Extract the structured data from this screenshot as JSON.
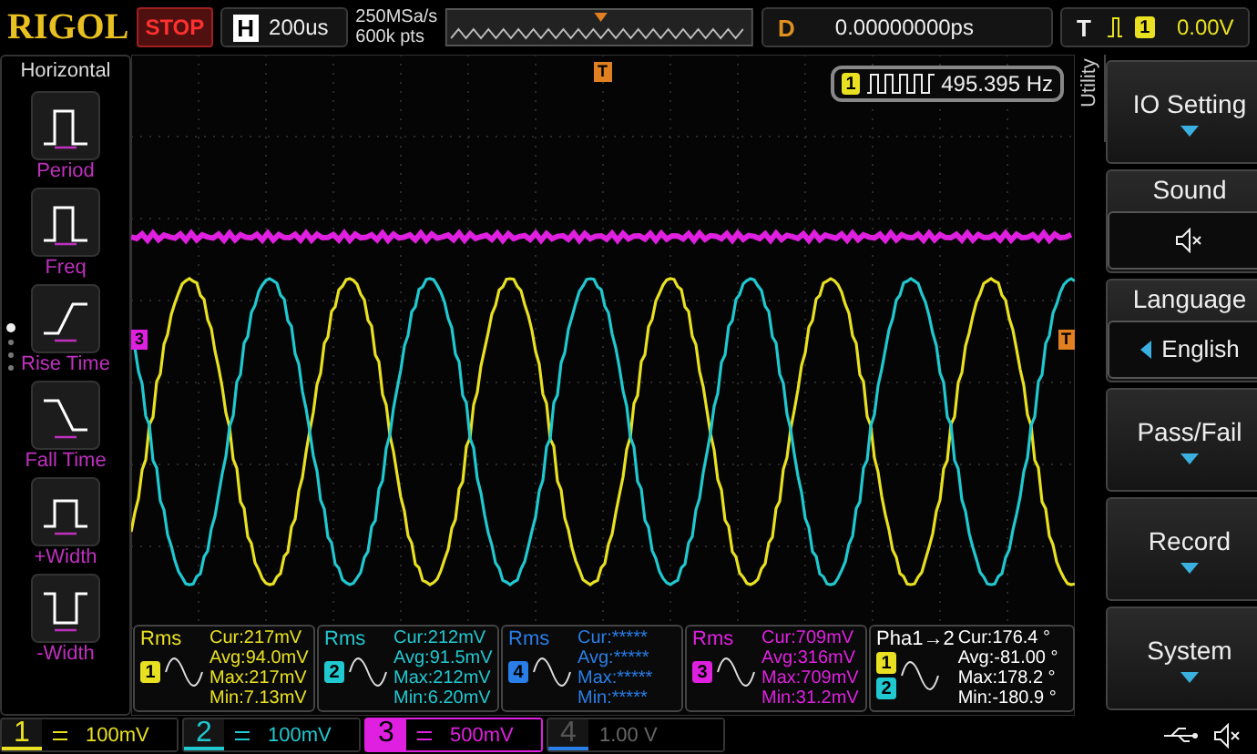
{
  "top_bar": {
    "brand": "RIGOL",
    "run_state": "STOP",
    "timebase": {
      "label": "H",
      "value": "200us"
    },
    "sample_rate": "250MSa/s",
    "memory_depth": "600k pts",
    "delay": {
      "label": "D",
      "value": "0.00000000ps"
    },
    "trigger": {
      "label": "T",
      "source": "1",
      "level": "0.00V"
    }
  },
  "grid": {
    "trigger_marker": "T",
    "level_marker": "T",
    "channel_marker": "3",
    "counter": {
      "source": "1",
      "value": "495.395 Hz"
    }
  },
  "left_menu": {
    "title": "Horizontal",
    "items": [
      {
        "label": "Period",
        "kind": "period",
        "selected": false
      },
      {
        "label": "Freq",
        "kind": "freq",
        "selected": false
      },
      {
        "label": "Rise Time",
        "kind": "rise",
        "selected": false
      },
      {
        "label": "Fall Time",
        "kind": "fall",
        "selected": false
      },
      {
        "label": "+Width",
        "kind": "pwidth",
        "selected": false
      },
      {
        "label": "-Width",
        "kind": "nwidth",
        "selected": false
      }
    ]
  },
  "right_menu": {
    "title": "Utility",
    "items": [
      {
        "label": "IO Setting",
        "kind": "submenu"
      },
      {
        "label": "Sound",
        "kind": "mute"
      },
      {
        "label": "Language",
        "kind": "choice",
        "value": "English"
      },
      {
        "label": "Pass/Fail",
        "kind": "submenu"
      },
      {
        "label": "Record",
        "kind": "submenu"
      },
      {
        "label": "System",
        "kind": "submenu"
      }
    ]
  },
  "measurements": [
    {
      "kind": "rms",
      "label": "Rms",
      "source": "1",
      "color": "#e8e020",
      "lines": [
        "Cur:217mV",
        "Avg:94.0mV",
        "Max:217mV",
        "Min:7.13mV"
      ]
    },
    {
      "kind": "rms",
      "label": "Rms",
      "source": "2",
      "color": "#20c8d0",
      "lines": [
        "Cur:212mV",
        "Avg:91.5mV",
        "Max:212mV",
        "Min:6.20mV"
      ]
    },
    {
      "kind": "rms",
      "label": "Rms",
      "source": "4",
      "color": "#2a7ee8",
      "lines": [
        "Cur:*****",
        "Avg:*****",
        "Max:*****",
        "Min:*****"
      ]
    },
    {
      "kind": "rms",
      "label": "Rms",
      "source": "3",
      "color": "#e020e0",
      "lines": [
        "Cur:709mV",
        "Avg:316mV",
        "Max:709mV",
        "Min:31.2mV"
      ]
    },
    {
      "kind": "phase",
      "label": "Pha1→2",
      "sources": [
        "1",
        "2"
      ],
      "color": "#ffffff",
      "lines": [
        "Cur:176.4 °",
        "Avg:-81.00 °",
        "Max:178.2 °",
        "Min:-180.9 °"
      ]
    }
  ],
  "channels": [
    {
      "number": "1",
      "scale": "100mV",
      "color": "#e8e020",
      "selected": false,
      "disabled": false
    },
    {
      "number": "2",
      "scale": "100mV",
      "color": "#20c8d0",
      "selected": false,
      "disabled": false
    },
    {
      "number": "3",
      "scale": "500mV",
      "color": "#e020e0",
      "selected": true,
      "disabled": false
    },
    {
      "number": "4",
      "scale": "1.00 V",
      "color": "#2a7ee8",
      "selected": false,
      "disabled": true
    }
  ]
}
